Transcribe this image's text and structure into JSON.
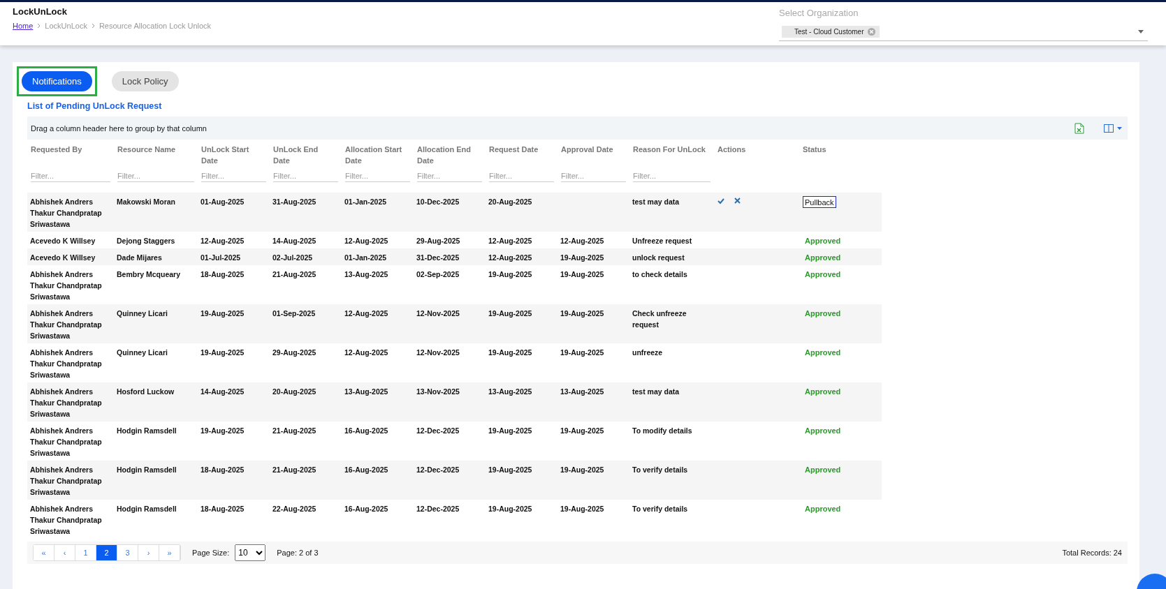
{
  "header": {
    "title": "LockUnLock",
    "breadcrumbs": [
      {
        "label": "Home",
        "link": true
      },
      {
        "label": "LockUnLock",
        "link": false
      },
      {
        "label": "Resource Allocation Lock Unlock",
        "link": false
      }
    ],
    "organization": {
      "label": "Select Organization",
      "chips": [
        "Test - Cloud Customer"
      ]
    }
  },
  "tabs": [
    {
      "label": "Notifications",
      "selected": true
    },
    {
      "label": "Lock Policy",
      "selected": false
    }
  ],
  "section_title": "List of Pending UnLock Request",
  "grid": {
    "group_hint": "Drag a column header here to group by that column",
    "columns": [
      {
        "label": "Requested By",
        "placeholder": "Filter..."
      },
      {
        "label": "Resource Name",
        "placeholder": "Filter..."
      },
      {
        "label": "UnLock Start Date",
        "placeholder": "Filter..."
      },
      {
        "label": "UnLock End Date",
        "placeholder": "Filter..."
      },
      {
        "label": "Allocation Start Date",
        "placeholder": "Filter..."
      },
      {
        "label": "Allocation End Date",
        "placeholder": "Filter..."
      },
      {
        "label": "Request Date",
        "placeholder": "Filter..."
      },
      {
        "label": "Approval Date",
        "placeholder": "Filter..."
      },
      {
        "label": "Reason For UnLock",
        "placeholder": "Filter..."
      },
      {
        "label": "Actions"
      },
      {
        "label": "Status"
      }
    ],
    "rows": [
      {
        "cells": [
          "Abhishek Andrers Thakur Chandpratap Sriwastawa",
          "Makowski Moran",
          "01-Aug-2025",
          "31-Aug-2025",
          "01-Jan-2025",
          "10-Dec-2025",
          "20-Aug-2025",
          "",
          "test may data"
        ],
        "actions": true,
        "status": {
          "label": "Pullback",
          "kind": "button"
        }
      },
      {
        "cells": [
          "Acevedo K Willsey",
          "Dejong Staggers",
          "12-Aug-2025",
          "14-Aug-2025",
          "12-Aug-2025",
          "29-Aug-2025",
          "12-Aug-2025",
          "12-Aug-2025",
          "Unfreeze request"
        ],
        "actions": false,
        "status": {
          "label": "Approved",
          "kind": "approved"
        }
      },
      {
        "cells": [
          "Acevedo K Willsey",
          "Dade Mijares",
          "01-Jul-2025",
          "02-Jul-2025",
          "01-Jan-2025",
          "31-Dec-2025",
          "12-Aug-2025",
          "19-Aug-2025",
          "unlock request"
        ],
        "actions": false,
        "status": {
          "label": "Approved",
          "kind": "approved"
        }
      },
      {
        "cells": [
          "Abhishek Andrers Thakur Chandpratap Sriwastawa",
          "Bembry Mcqueary",
          "18-Aug-2025",
          "21-Aug-2025",
          "13-Aug-2025",
          "02-Sep-2025",
          "19-Aug-2025",
          "19-Aug-2025",
          "to check details"
        ],
        "actions": false,
        "status": {
          "label": "Approved",
          "kind": "approved"
        }
      },
      {
        "cells": [
          "Abhishek Andrers Thakur Chandpratap Sriwastawa",
          "Quinney Licari",
          "19-Aug-2025",
          "01-Sep-2025",
          "12-Aug-2025",
          "12-Nov-2025",
          "19-Aug-2025",
          "19-Aug-2025",
          "Check unfreeze request"
        ],
        "actions": false,
        "status": {
          "label": "Approved",
          "kind": "approved"
        }
      },
      {
        "cells": [
          "Abhishek Andrers Thakur Chandpratap Sriwastawa",
          "Quinney Licari",
          "19-Aug-2025",
          "29-Aug-2025",
          "12-Aug-2025",
          "12-Nov-2025",
          "19-Aug-2025",
          "19-Aug-2025",
          "unfreeze"
        ],
        "actions": false,
        "status": {
          "label": "Approved",
          "kind": "approved"
        }
      },
      {
        "cells": [
          "Abhishek Andrers Thakur Chandpratap Sriwastawa",
          "Hosford Luckow",
          "14-Aug-2025",
          "20-Aug-2025",
          "13-Aug-2025",
          "13-Nov-2025",
          "13-Aug-2025",
          "13-Aug-2025",
          "test may data"
        ],
        "actions": false,
        "status": {
          "label": "Approved",
          "kind": "approved"
        }
      },
      {
        "cells": [
          "Abhishek Andrers Thakur Chandpratap Sriwastawa",
          "Hodgin Ramsdell",
          "19-Aug-2025",
          "21-Aug-2025",
          "16-Aug-2025",
          "12-Dec-2025",
          "19-Aug-2025",
          "19-Aug-2025",
          "To modify details"
        ],
        "actions": false,
        "status": {
          "label": "Approved",
          "kind": "approved"
        }
      },
      {
        "cells": [
          "Abhishek Andrers Thakur Chandpratap Sriwastawa",
          "Hodgin Ramsdell",
          "18-Aug-2025",
          "21-Aug-2025",
          "16-Aug-2025",
          "12-Dec-2025",
          "19-Aug-2025",
          "19-Aug-2025",
          "To verify details"
        ],
        "actions": false,
        "status": {
          "label": "Approved",
          "kind": "approved"
        }
      },
      {
        "cells": [
          "Abhishek Andrers Thakur Chandpratap Sriwastawa",
          "Hodgin Ramsdell",
          "18-Aug-2025",
          "22-Aug-2025",
          "16-Aug-2025",
          "12-Dec-2025",
          "19-Aug-2025",
          "19-Aug-2025",
          "To verify details"
        ],
        "actions": false,
        "status": {
          "label": "Approved",
          "kind": "approved"
        }
      }
    ]
  },
  "pager": {
    "buttons": [
      {
        "label": "«",
        "selected": false
      },
      {
        "label": "‹",
        "selected": false
      },
      {
        "label": "1",
        "selected": false
      },
      {
        "label": "2",
        "selected": true
      },
      {
        "label": "3",
        "selected": false
      },
      {
        "label": "›",
        "selected": false
      },
      {
        "label": "»",
        "selected": false
      }
    ],
    "page_size_label": "Page Size:",
    "page_size": "10",
    "page_info": "Page: 2 of 3",
    "total": "Total Records: 24"
  }
}
